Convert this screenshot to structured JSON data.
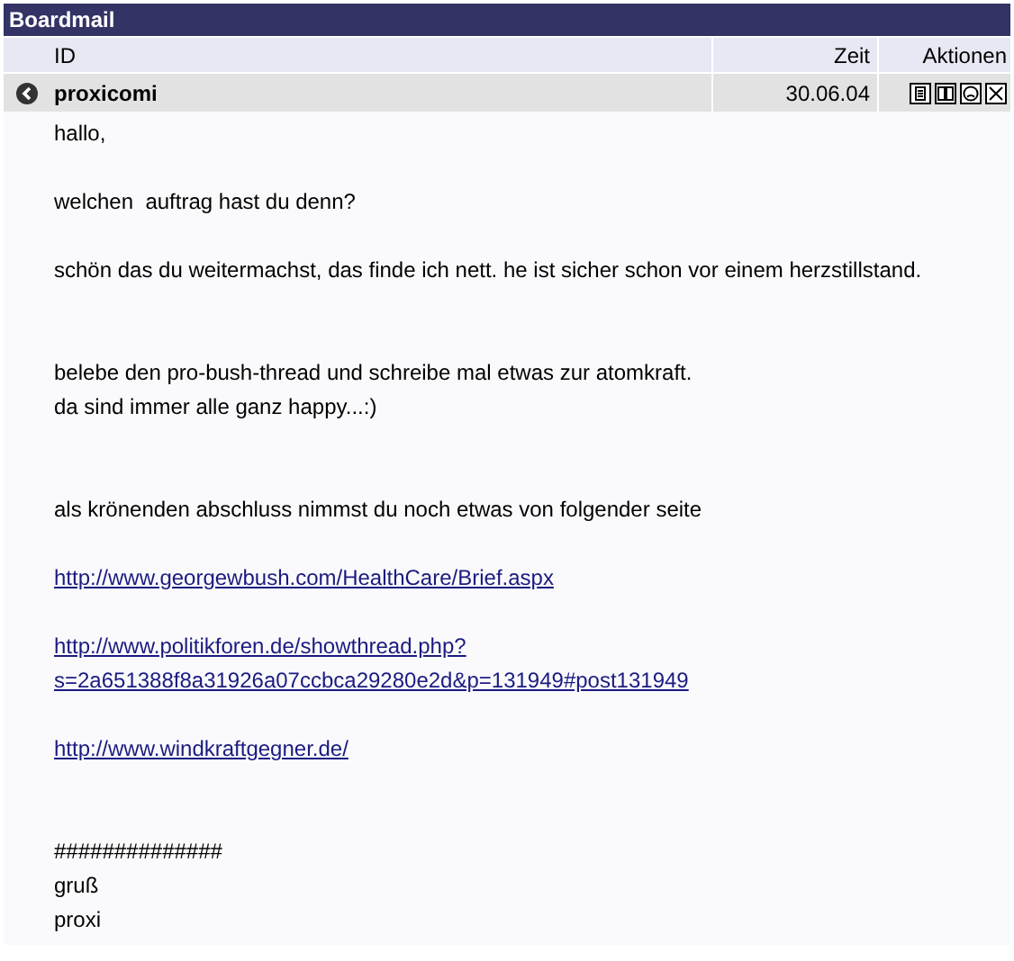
{
  "window": {
    "title": "Boardmail"
  },
  "columns": [
    {
      "label": "ID"
    },
    {
      "label": "Zeit"
    },
    {
      "label": "Aktionen"
    }
  ],
  "message": {
    "sender": "proxicomi",
    "time": "30.06.04",
    "lines": [
      {
        "kind": "text",
        "text": "hallo,"
      },
      {
        "kind": "blank"
      },
      {
        "kind": "text",
        "text": "welchen  auftrag hast du denn?"
      },
      {
        "kind": "blank"
      },
      {
        "kind": "text",
        "text": "schön das du weitermachst, das finde ich nett. he ist sicher schon vor einem herzstillstand."
      },
      {
        "kind": "blank"
      },
      {
        "kind": "blank"
      },
      {
        "kind": "text",
        "text": "belebe den pro-bush-thread und schreibe mal etwas zur atomkraft."
      },
      {
        "kind": "text",
        "text": "da sind immer alle ganz happy...:)"
      },
      {
        "kind": "blank"
      },
      {
        "kind": "blank"
      },
      {
        "kind": "text",
        "text": "als krönenden abschluss nimmst du noch etwas von folgender seite"
      },
      {
        "kind": "blank"
      },
      {
        "kind": "link",
        "text": "http://www.georgewbush.com/HealthCare/Brief.aspx"
      },
      {
        "kind": "blank"
      },
      {
        "kind": "link",
        "text": "http://www.politikforen.de/showthread.php?s=2a651388f8a31926a07ccbca29280e2d&p=131949#post131949"
      },
      {
        "kind": "blank"
      },
      {
        "kind": "link",
        "text": "http://www.windkraftgegner.de/"
      },
      {
        "kind": "blank"
      },
      {
        "kind": "blank"
      },
      {
        "kind": "text",
        "text": "##############"
      },
      {
        "kind": "text",
        "text": "gruß"
      },
      {
        "kind": "text",
        "text": "proxi"
      }
    ]
  }
}
